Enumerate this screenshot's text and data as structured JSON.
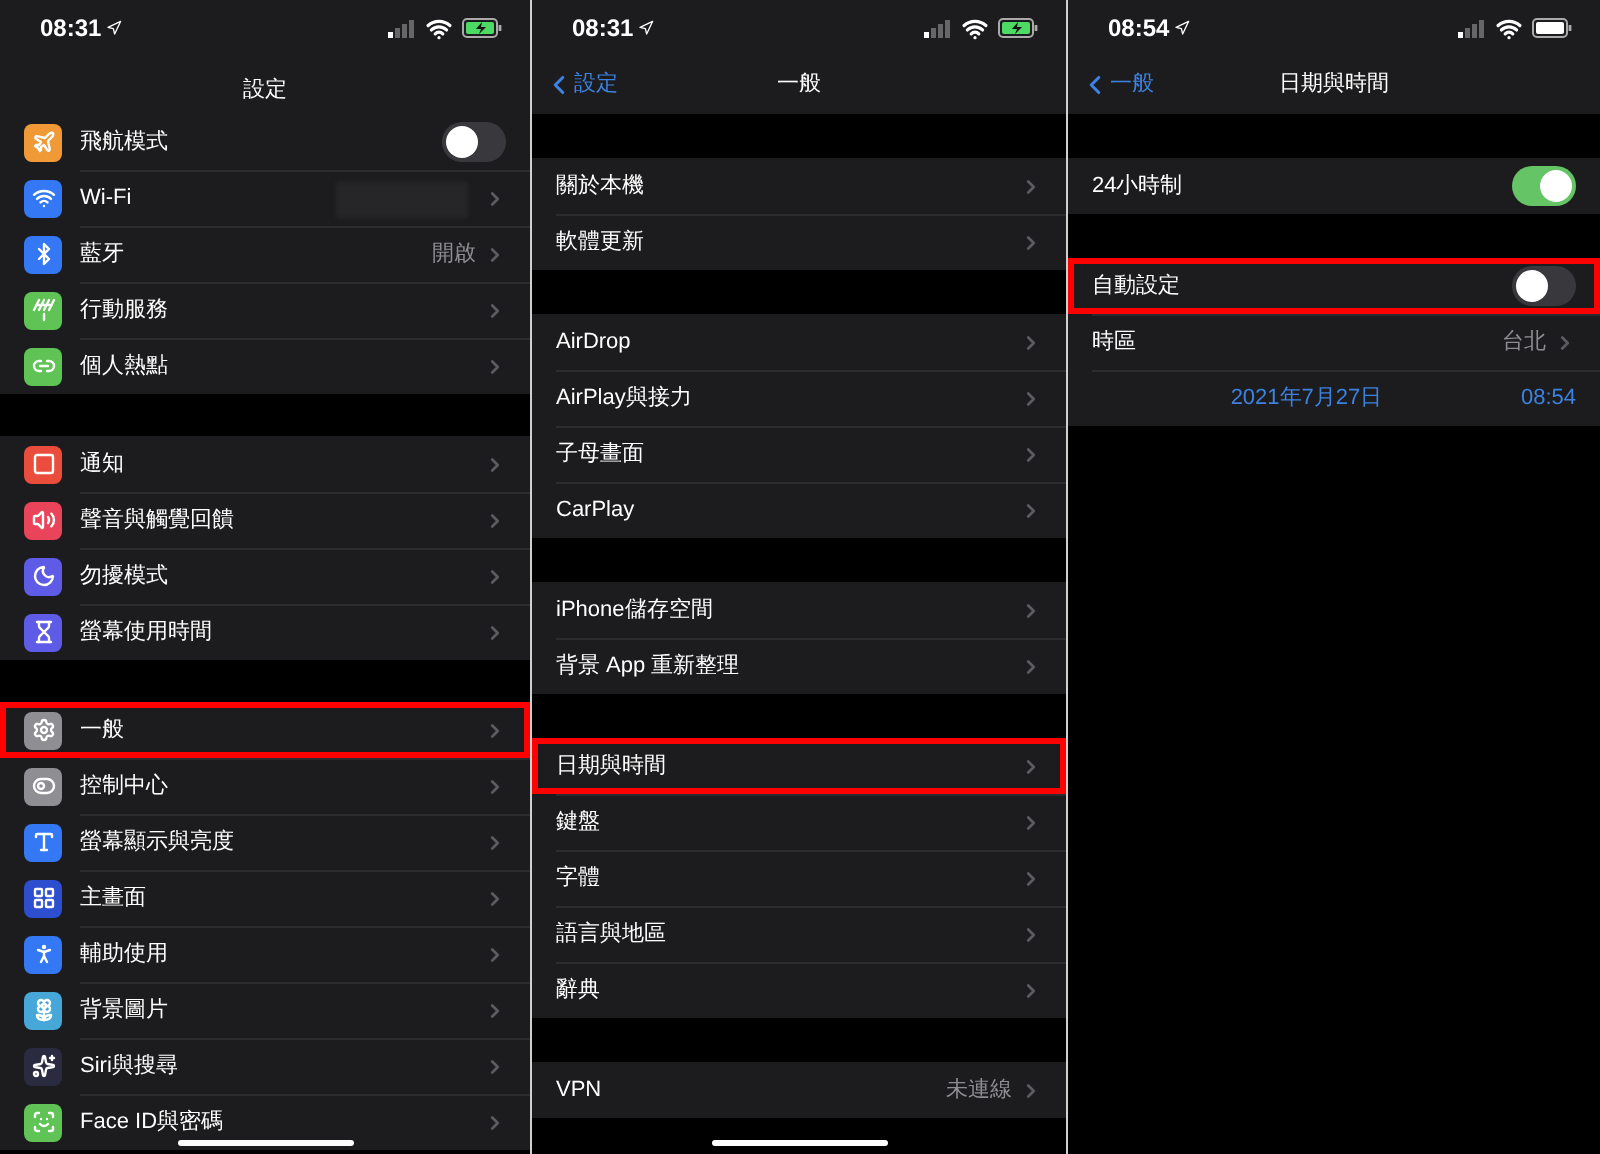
{
  "panels": [
    {
      "status_bar": {
        "time": "08:31",
        "battery_charging": true
      },
      "nav": {
        "title": "設定"
      },
      "groups": [
        [
          {
            "label": "飛航模式",
            "kind": "toggle",
            "color": "#f09a37",
            "on": false,
            "highlighted": false
          },
          {
            "label": "Wi-Fi",
            "kind": "link",
            "color": "#3478f6",
            "redacted": true,
            "highlighted": false
          },
          {
            "label": "藍牙",
            "kind": "link",
            "color": "#3478f6",
            "value": "開啟",
            "highlighted": false
          },
          {
            "label": "行動服務",
            "kind": "link",
            "color": "#5fc455",
            "highlighted": false
          },
          {
            "label": "個人熱點",
            "kind": "link",
            "color": "#5fc455",
            "highlighted": false
          }
        ],
        [
          {
            "label": "通知",
            "kind": "link",
            "color": "#eb4d3d",
            "highlighted": false
          },
          {
            "label": "聲音與觸覺回饋",
            "kind": "link",
            "color": "#ea445a",
            "highlighted": false
          },
          {
            "label": "勿擾模式",
            "kind": "link",
            "color": "#5e5ce6",
            "highlighted": false
          },
          {
            "label": "螢幕使用時間",
            "kind": "link",
            "color": "#5e5ce6",
            "highlighted": false
          }
        ],
        [
          {
            "label": "一般",
            "kind": "link",
            "color": "#8e8e93",
            "highlighted": true
          },
          {
            "label": "控制中心",
            "kind": "link",
            "color": "#8e8e93",
            "highlighted": false
          },
          {
            "label": "螢幕顯示與亮度",
            "kind": "link",
            "color": "#3478f6",
            "highlighted": false
          },
          {
            "label": "主畫面",
            "kind": "link",
            "color": "#2c4ecf",
            "highlighted": false
          },
          {
            "label": "輔助使用",
            "kind": "link",
            "color": "#3478f6",
            "highlighted": false
          },
          {
            "label": "背景圖片",
            "kind": "link",
            "color": "#46a7d8",
            "highlighted": false
          },
          {
            "label": "Siri與搜尋",
            "kind": "link",
            "color": "#2a2a40",
            "highlighted": false
          },
          {
            "label": "Face ID與密碼",
            "kind": "link",
            "color": "#5fc455",
            "highlighted": false
          }
        ]
      ]
    },
    {
      "status_bar": {
        "time": "08:31",
        "battery_charging": true
      },
      "nav": {
        "back": "設定",
        "title": "一般"
      },
      "groups": [
        [
          {
            "label": "關於本機",
            "kind": "link",
            "highlighted": false
          },
          {
            "label": "軟體更新",
            "kind": "link",
            "highlighted": false
          }
        ],
        [
          {
            "label": "AirDrop",
            "kind": "link",
            "highlighted": false
          },
          {
            "label": "AirPlay與接力",
            "kind": "link",
            "highlighted": false
          },
          {
            "label": "子母畫面",
            "kind": "link",
            "highlighted": false
          },
          {
            "label": "CarPlay",
            "kind": "link",
            "highlighted": false
          }
        ],
        [
          {
            "label": "iPhone儲存空間",
            "kind": "link",
            "highlighted": false
          },
          {
            "label": "背景 App 重新整理",
            "kind": "link",
            "highlighted": false
          }
        ],
        [
          {
            "label": "日期與時間",
            "kind": "link",
            "highlighted": true
          },
          {
            "label": "鍵盤",
            "kind": "link",
            "highlighted": false
          },
          {
            "label": "字體",
            "kind": "link",
            "highlighted": false
          },
          {
            "label": "語言與地區",
            "kind": "link",
            "highlighted": false
          },
          {
            "label": "辭典",
            "kind": "link",
            "highlighted": false
          }
        ],
        [
          {
            "label": "VPN",
            "kind": "link",
            "value": "未連線",
            "highlighted": false
          }
        ]
      ]
    },
    {
      "status_bar": {
        "time": "08:54",
        "battery_charging": false
      },
      "nav": {
        "back": "一般",
        "title": "日期與時間"
      },
      "groups": [
        [
          {
            "label": "24小時制",
            "kind": "toggle",
            "on": true,
            "highlighted": false
          }
        ],
        [
          {
            "label": "自動設定",
            "kind": "toggle",
            "on": false,
            "highlighted": true
          },
          {
            "label": "時區",
            "kind": "link",
            "value": "台北",
            "highlighted": false
          },
          {
            "kind": "datetime",
            "date": "2021年7月27日",
            "time": "08:54",
            "highlighted": false
          }
        ]
      ]
    }
  ]
}
